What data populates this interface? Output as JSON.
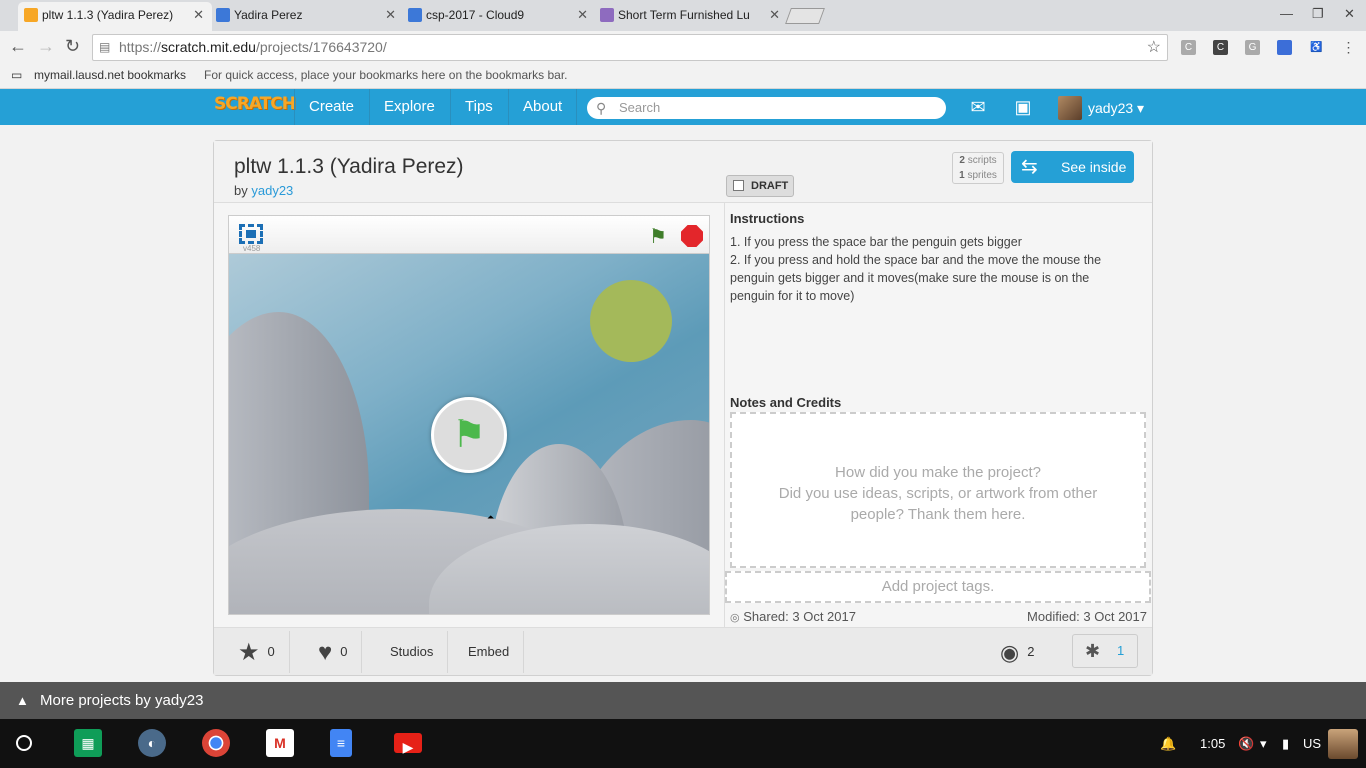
{
  "browser": {
    "tabs": [
      {
        "title": "pltw 1.1.3 (Yadira Perez)",
        "active": true
      },
      {
        "title": "Yadira Perez",
        "active": false
      },
      {
        "title": "csp-2017 - Cloud9",
        "active": false
      },
      {
        "title": "Short Term Furnished Lu",
        "active": false
      }
    ],
    "url_scheme": "https://",
    "url_host": "scratch.mit.edu",
    "url_path": "/projects/176643720/",
    "bookmarks_folder": "mymail.lausd.net bookmarks",
    "bookmarks_hint": "For quick access, place your bookmarks here on the bookmarks bar."
  },
  "scratch_nav": {
    "logo": "SCRATCH",
    "items": [
      "Create",
      "Explore",
      "Tips",
      "About"
    ],
    "search_placeholder": "Search",
    "username": "yady23 ▾"
  },
  "project": {
    "title": "pltw 1.1.3 (Yadira Perez)",
    "by_label": "by",
    "author": "yady23",
    "draft_label": "DRAFT",
    "scripts_count": "2",
    "scripts_label": "scripts",
    "sprites_count": "1",
    "sprites_label": "sprites",
    "see_inside": "See inside",
    "version": "v458",
    "instructions_title": "Instructions",
    "instructions_line1": "1. If you press the space bar the penguin gets bigger",
    "instructions_line2": "2. If you press and hold the space bar and the move the mouse the penguin gets bigger and it moves(make sure the mouse is on the penguin for it to move)",
    "notes_title": "Notes and Credits",
    "notes_placeholder_1": "How did you make the project?",
    "notes_placeholder_2": "Did you use ideas, scripts, or artwork from other people? Thank them here.",
    "tags_placeholder": "Add project tags.",
    "shared": "Shared: 3 Oct 2017",
    "modified": "Modified: 3 Oct 2017",
    "stars": "0",
    "loves": "0",
    "studios_label": "Studios",
    "embed_label": "Embed",
    "views": "2",
    "remixes": "1"
  },
  "more_projects": "More projects by yady23",
  "system": {
    "time": "1:05",
    "locale": "US"
  }
}
